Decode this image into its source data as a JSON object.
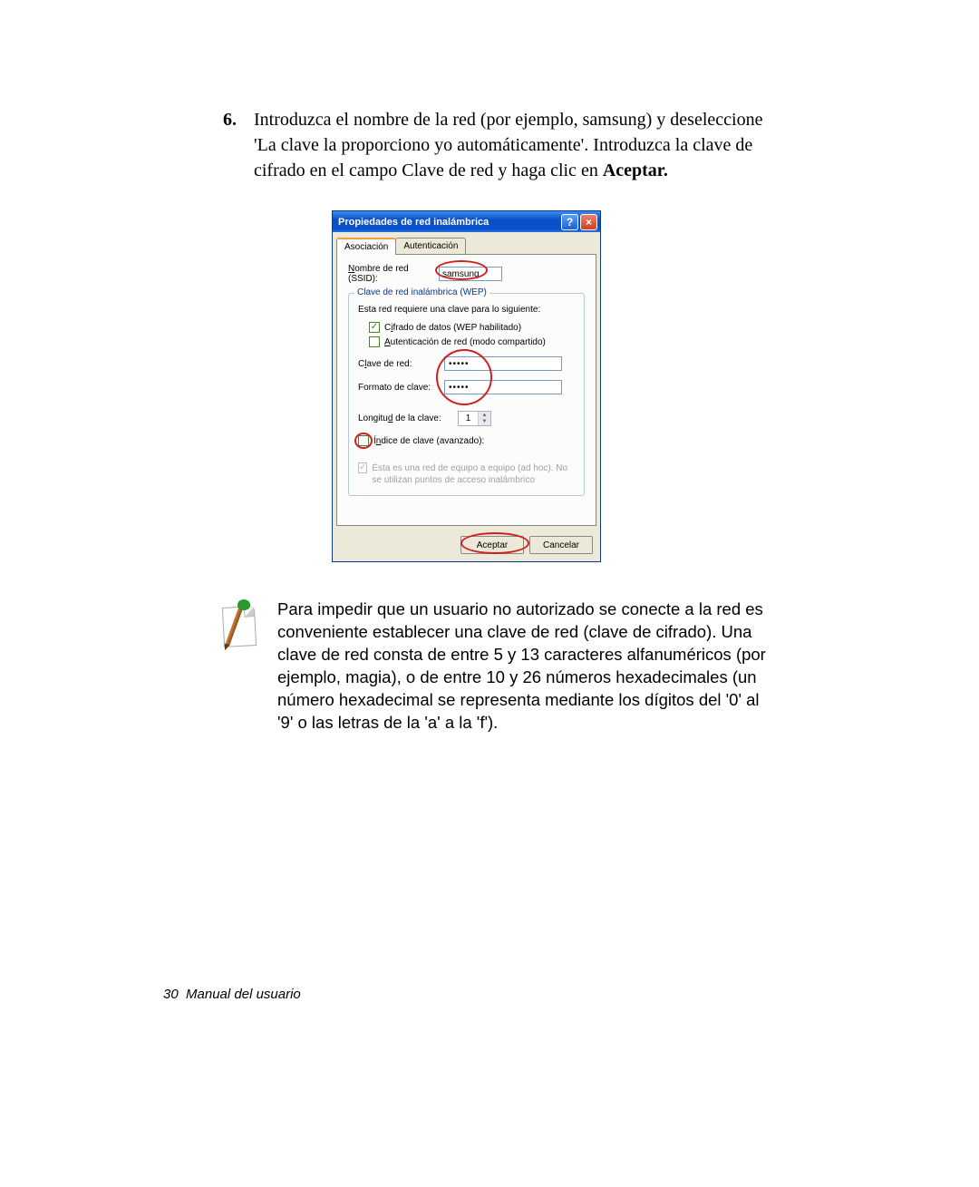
{
  "step": {
    "number": "6.",
    "text_before_bold": "Introduzca el nombre de la red (por ejemplo, samsung) y deseleccione 'La clave la proporciono yo automáticamente'. Introduzca la clave de cifrado en el campo Clave de red y haga clic en ",
    "bold": "Aceptar."
  },
  "dialog": {
    "title": "Propiedades de red inalámbrica",
    "help": "?",
    "close": "×",
    "tabs": {
      "assoc": "Asociación",
      "auth": "Autenticación"
    },
    "ssid_label": "Nombre de red (SSID):",
    "ssid_value": "samsung",
    "fieldset_legend": "Clave de red inalámbrica (WEP)",
    "req_text": "Esta red requiere una clave para lo siguiente:",
    "cb_cifrado": "Cifrado de datos (WEP habilitado)",
    "cb_auth": "Autenticación de red (modo compartido)",
    "clave_label": "Clave de red:",
    "formato_label": "Formato de clave:",
    "dots": "•••••",
    "longitud_label": "Longitud de la clave:",
    "longitud_value": "1",
    "indice_label": "Índice de clave (avanzado):",
    "adhoc_text": "Ésta es una red de equipo a equipo (ad hoc). No se utilizan puntos de acceso inalámbrico",
    "btn_ok": "Aceptar",
    "btn_cancel": "Cancelar"
  },
  "note": "Para impedir que un usuario no autorizado se conecte a la red es conveniente establecer una clave de red (clave de cifrado). Una clave de red consta de entre 5 y 13 caracteres alfanuméricos (por ejemplo, magia), o de entre 10 y 26 números hexadecimales (un número hexadecimal se representa mediante los dígitos del '0' al '9' o las letras de la 'a' a la 'f').",
  "footer": {
    "page": "30",
    "title": "Manual del usuario"
  }
}
